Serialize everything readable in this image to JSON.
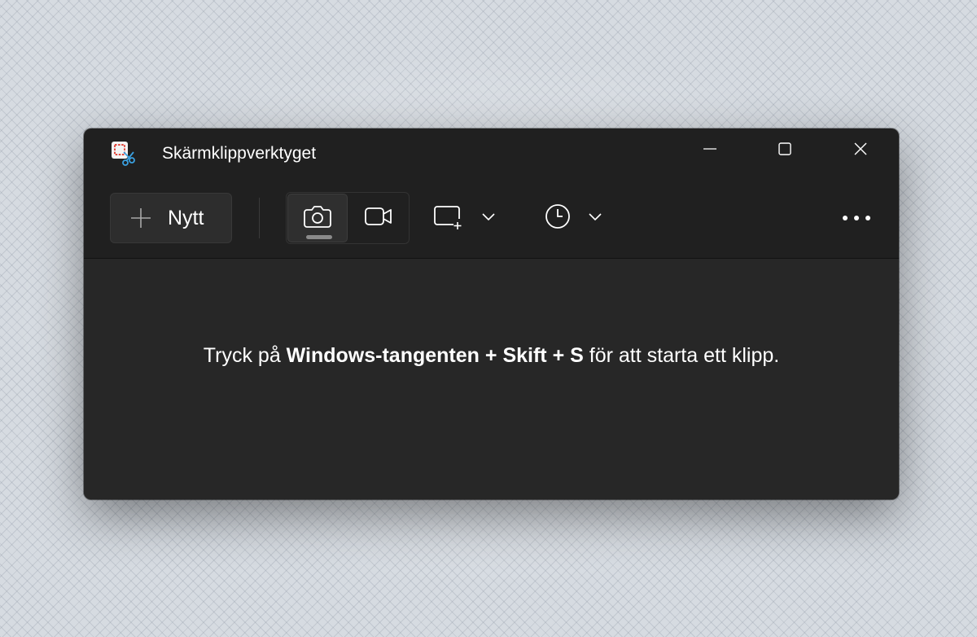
{
  "window": {
    "title": "Skärmklippverktyget",
    "app_icon": "snipping-tool-icon",
    "controls": {
      "minimize_icon": "minimize-icon",
      "maximize_icon": "maximize-icon",
      "close_icon": "close-icon"
    }
  },
  "toolbar": {
    "new_label": "Nytt",
    "new_icon": "plus-icon",
    "modes": [
      {
        "name": "screenshot",
        "icon": "camera-icon",
        "selected": true
      },
      {
        "name": "video",
        "icon": "video-camera-icon",
        "selected": false
      }
    ],
    "shape_icon": "rectangle-snip-icon",
    "delay_icon": "clock-icon",
    "dropdown_icon": "chevron-down-icon",
    "more_icon": "more-options-icon"
  },
  "main": {
    "hint_part1": "Tryck på ",
    "hint_key1": "Windows-tangenten",
    "hint_plus1": " + ",
    "hint_key2": "Skift",
    "hint_plus2": " + ",
    "hint_key3": "S",
    "hint_part2": " för att starta ett klipp."
  },
  "colors": {
    "window_bg": "#202020",
    "content_bg": "#272727",
    "button_bg": "#2d2d2d",
    "text": "#ffffff",
    "accent_red": "#e0463c"
  }
}
